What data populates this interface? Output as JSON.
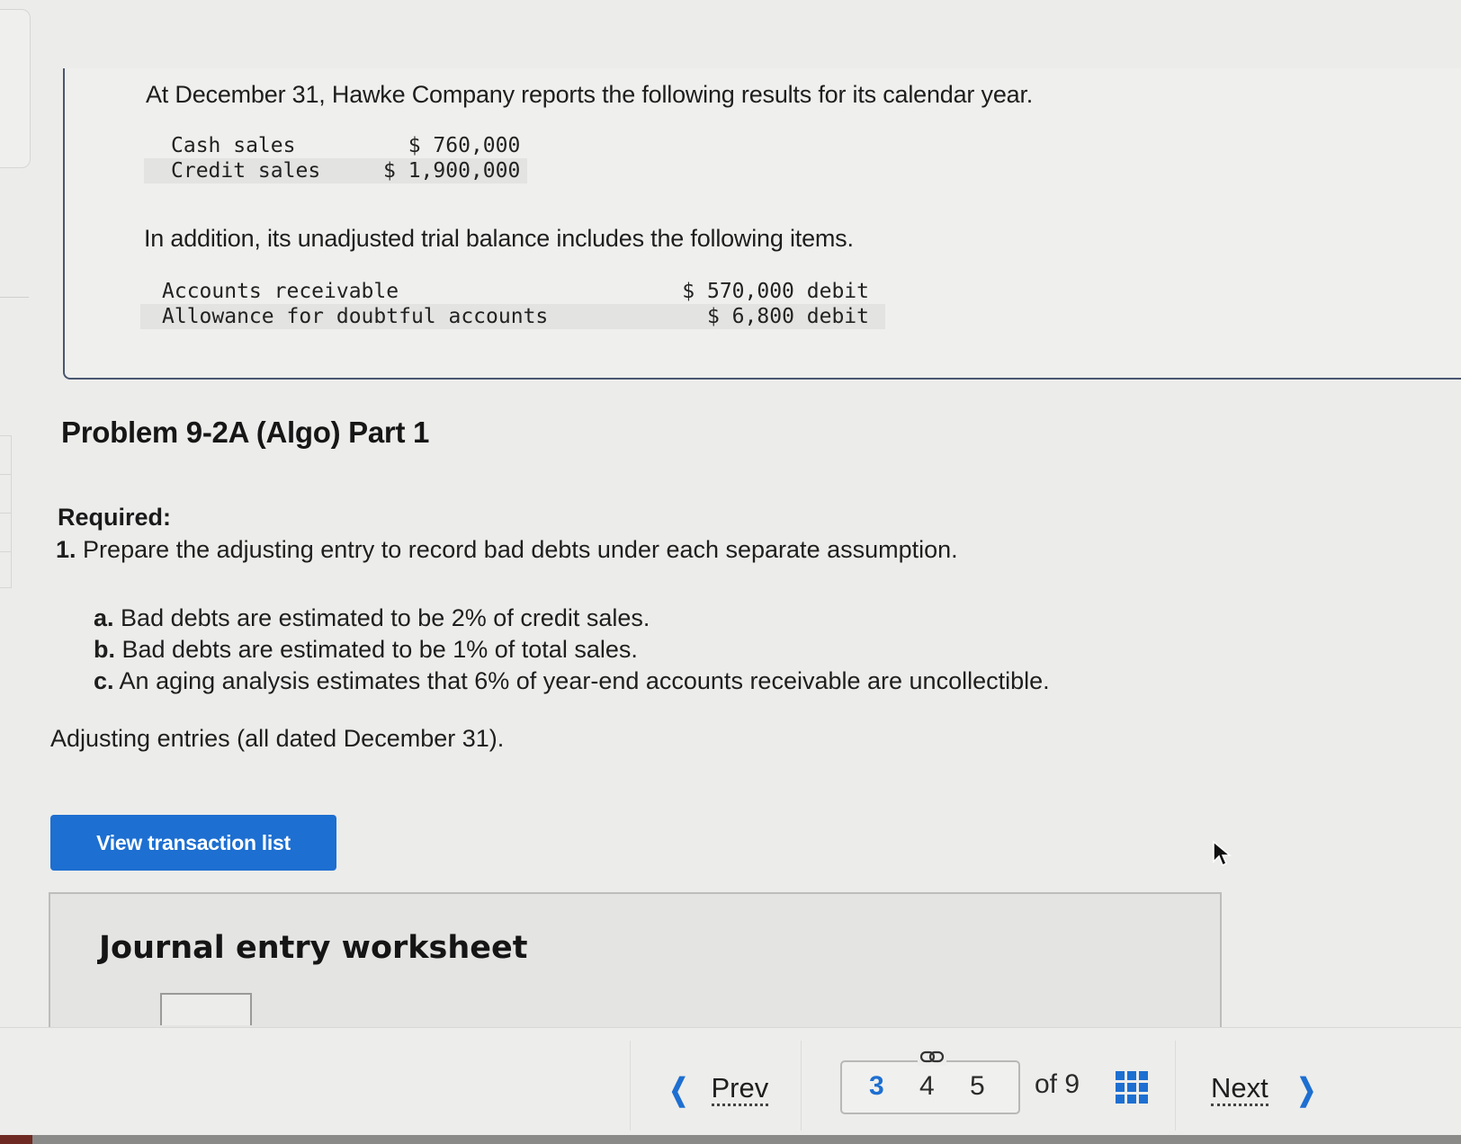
{
  "scenario": {
    "intro": "At December 31, Hawke Company reports the following results for its calendar year.",
    "sales": [
      {
        "label": "Cash sales",
        "value": "$ 760,000"
      },
      {
        "label": "Credit sales",
        "value": "$ 1,900,000"
      }
    ],
    "trial_balance_intro": "In addition, its unadjusted trial balance includes the following items.",
    "trial_balance": [
      {
        "label": "Accounts receivable",
        "value": "$ 570,000 debit"
      },
      {
        "label": "Allowance for doubtful accounts",
        "value": "$ 6,800 debit"
      }
    ]
  },
  "problem": {
    "title": "Problem 9-2A (Algo) Part 1",
    "required_label": "Required:",
    "required_items": [
      {
        "number": "1.",
        "text": "Prepare the adjusting entry to record bad debts under each separate assumption."
      }
    ],
    "assumptions": [
      {
        "letter": "a.",
        "text": "Bad debts are estimated to be 2% of credit sales."
      },
      {
        "letter": "b.",
        "text": "Bad debts are estimated to be 1% of total sales."
      },
      {
        "letter": "c.",
        "text": "An aging analysis estimates that 6% of year-end accounts receivable are uncollectible."
      }
    ],
    "note": "Adjusting entries (all dated December 31)."
  },
  "actions": {
    "view_transaction_list": "View transaction list"
  },
  "worksheet": {
    "title": "Journal entry worksheet"
  },
  "navigation": {
    "prev_label": "Prev",
    "next_label": "Next",
    "pages": [
      "3",
      "4",
      "5"
    ],
    "current_page": "3",
    "of_label": "of 9",
    "accent_color": "#1d6fd1"
  }
}
